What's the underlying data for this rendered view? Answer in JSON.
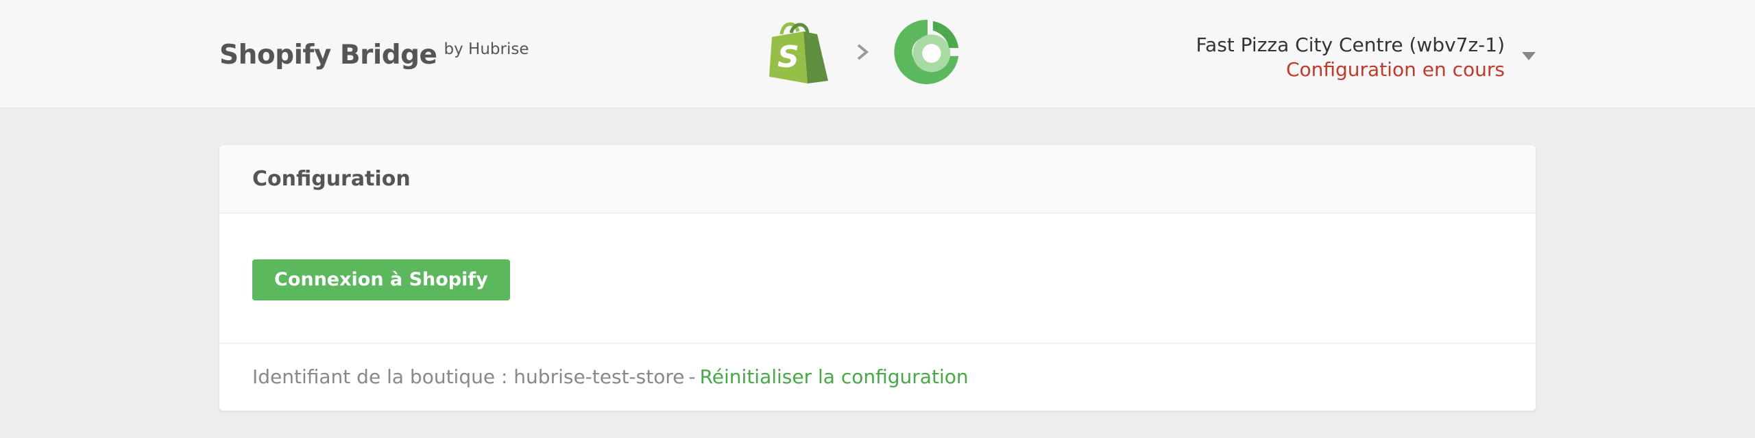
{
  "header": {
    "title": "Shopify Bridge",
    "subtitle": "by Hubrise",
    "logos": {
      "left": "shopify-bag-icon",
      "separator": "chevron-right-icon",
      "right": "hubrise-ring-icon"
    },
    "account": {
      "name": "Fast Pizza City Centre (wbv7z-1)",
      "status": "Configuration en cours",
      "status_color": "#c0392b"
    }
  },
  "card": {
    "title": "Configuration",
    "connect_button_label": "Connexion à Shopify",
    "footer": {
      "store_id_text": "Identifiant de la boutique : hubrise-test-store",
      "separator": "-",
      "reset_link_label": "Réinitialiser la configuration"
    }
  },
  "colors": {
    "accent_green": "#5cb85c",
    "link_green": "#46a846",
    "background": "#ededed",
    "topbar": "#f7f7f7"
  }
}
